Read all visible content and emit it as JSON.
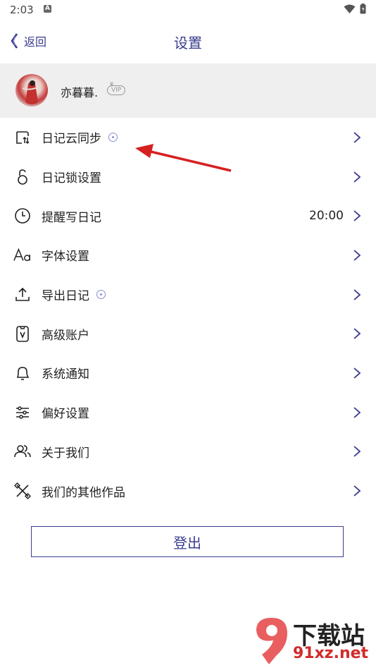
{
  "status": {
    "time": "2:03",
    "notif_icon": "A"
  },
  "header": {
    "back_label": "返回",
    "title": "设置"
  },
  "profile": {
    "name": "亦暮暮.",
    "badge": "VIP"
  },
  "menu": [
    {
      "label": "日记云同步",
      "icon": "cloud-sync-icon",
      "dot": true,
      "value": ""
    },
    {
      "label": "日记锁设置",
      "icon": "lock-icon",
      "dot": false,
      "value": ""
    },
    {
      "label": "提醒写日记",
      "icon": "clock-icon",
      "dot": false,
      "value": "20:00"
    },
    {
      "label": "字体设置",
      "icon": "font-icon",
      "dot": false,
      "value": ""
    },
    {
      "label": "导出日记",
      "icon": "export-icon",
      "dot": true,
      "value": ""
    },
    {
      "label": "高级账户",
      "icon": "vip-account-icon",
      "dot": false,
      "value": ""
    },
    {
      "label": "系统通知",
      "icon": "bell-icon",
      "dot": false,
      "value": ""
    },
    {
      "label": "偏好设置",
      "icon": "sliders-icon",
      "dot": false,
      "value": ""
    },
    {
      "label": "关于我们",
      "icon": "people-icon",
      "dot": false,
      "value": ""
    },
    {
      "label": "我们的其他作品",
      "icon": "tools-icon",
      "dot": false,
      "value": ""
    }
  ],
  "logout_label": "登出",
  "watermark": {
    "line1": "下载站",
    "line2": "91xz.net"
  },
  "colors": {
    "accent": "#3a3d8f",
    "profile_bg": "#efefef",
    "arrow": "#d62020"
  }
}
